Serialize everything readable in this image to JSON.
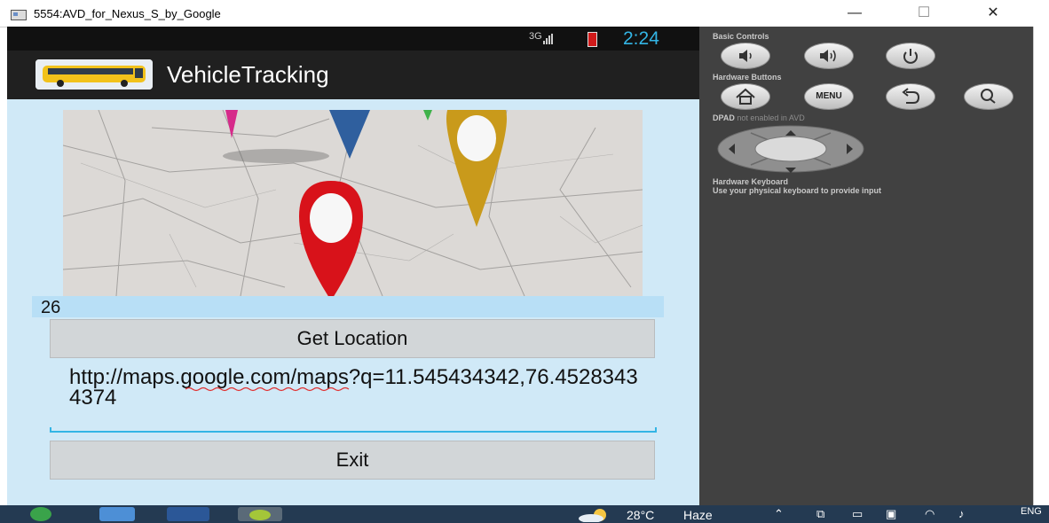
{
  "window": {
    "title": "5554:AVD_for_Nexus_S_by_Google",
    "minimize_glyph": "—",
    "maximize_glyph": "☐",
    "close_glyph": "✕"
  },
  "status_bar": {
    "network": "3G",
    "time": "2:24",
    "battery_color": "#d01a1a",
    "time_color": "#33b5e5"
  },
  "app": {
    "title": "VehicleTracking",
    "icon": "bus-icon"
  },
  "content": {
    "value": "26",
    "get_location_label": "Get Location",
    "url_text": "http://maps.google.com/maps?q=11.545434342,76.45283434374",
    "exit_label": "Exit",
    "background": "#d0e9f7",
    "accent": "#33b5e5"
  },
  "panel": {
    "basic_controls_label": "Basic Controls",
    "hardware_buttons_label": "Hardware Buttons",
    "menu_label": "MENU",
    "dpad_label_bold": "DPAD",
    "dpad_label_rest": " not enabled in AVD",
    "keyboard_title": "Hardware Keyboard",
    "keyboard_hint": "Use your physical keyboard to provide input"
  },
  "taskbar": {
    "temperature": "28°C",
    "weather": "Haze",
    "language": "ENG",
    "icons": [
      "start-icon",
      "browser-icon",
      "word-icon",
      "android-icon"
    ]
  }
}
